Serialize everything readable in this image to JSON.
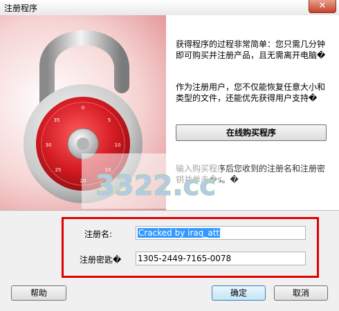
{
  "window": {
    "title": "注册程序",
    "close_glyph": "✕"
  },
  "info": {
    "text1": "获得程序的过程非常简单：您只需几分钟即可购买并注册产品，且无需离开电脑�",
    "text2": "作为注册用户，您不仅能恢复任意大小和类型的文件，还能优先获得用户支持�",
    "buy_button": "在线购买程序",
    "text3": "输入购买程序后您收到的注册名和注册密钥并单击�s。�"
  },
  "watermark": {
    "text": "3322.cc",
    "subtext": ""
  },
  "form": {
    "name_label": "注册名:",
    "name_value": "Cracked by iraq_att",
    "key_label": "注册密匙�",
    "key_value": "1305-2449-7165-0078"
  },
  "buttons": {
    "help": "帮助",
    "ok": "确定",
    "cancel": "取消"
  },
  "icons": {
    "lock": "padlock-icon"
  },
  "colors": {
    "highlight": "#e00000",
    "lock_red": "#c0141c",
    "selection": "#3399ff"
  }
}
